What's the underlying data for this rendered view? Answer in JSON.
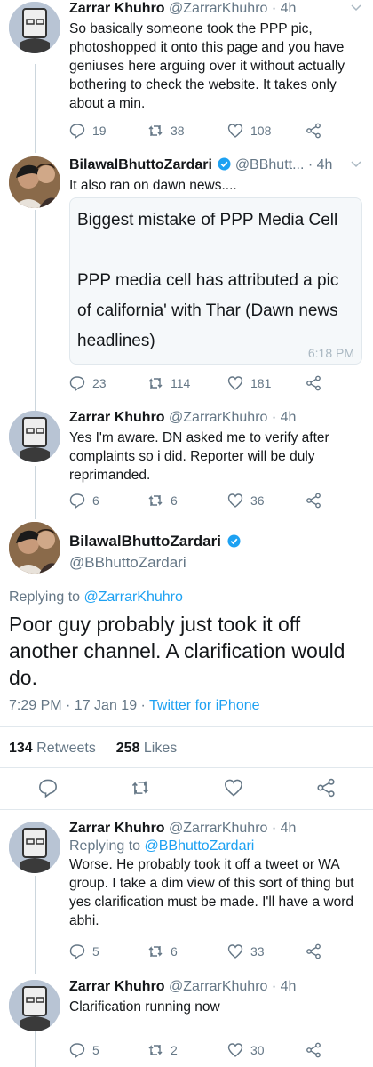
{
  "tweets": [
    {
      "name": "Zarrar Khuhro",
      "handle": "@ZarrarKhuhro",
      "time": "· 4h",
      "text": "So basically someone took the PPP pic, photoshopped it onto this page and you have geniuses here arguing over it without actually bothering to check the website. It takes only about a min.",
      "replies": "19",
      "retweets": "38",
      "likes": "108"
    },
    {
      "name": "BilawalBhuttoZardari",
      "handle": "@BBhutt...",
      "time": "· 4h",
      "text": "It also ran on dawn news....",
      "quote_text": "Biggest mistake of PPP Media Cell\n\nPPP media cell has attributed a pic of california' with Thar (Dawn news headlines)",
      "quote_time": "6:18 PM",
      "replies": "23",
      "retweets": "114",
      "likes": "181"
    },
    {
      "name": "Zarrar Khuhro",
      "handle": "@ZarrarKhuhro",
      "time": "· 4h",
      "text": "Yes I'm aware. DN asked me to verify after complaints so i did. Reporter will be duly reprimanded.",
      "replies": "6",
      "retweets": "6",
      "likes": "36"
    }
  ],
  "main": {
    "name": "BilawalBhuttoZardari",
    "handle": "@BBhuttoZardari",
    "replying_prefix": "Replying to ",
    "replying_to": "@ZarrarKhuhro",
    "text": "Poor guy probably just took it off another channel. A clarification would do.",
    "time": "7:29 PM · 17 Jan 19 · ",
    "client": "Twitter for iPhone",
    "retweet_count": "134",
    "retweet_label": " Retweets",
    "like_count": "258",
    "like_label": " Likes"
  },
  "replies_below": [
    {
      "name": "Zarrar Khuhro",
      "handle": "@ZarrarKhuhro",
      "time": "· 4h",
      "replying_prefix": "Replying to ",
      "replying_to": "@BBhuttoZardari",
      "text": "Worse. He probably took it off a tweet or WA group. I take a dim view of this sort of thing but yes clarification must be made. I'll have a word abhi.",
      "replies": "5",
      "retweets": "6",
      "likes": "33"
    },
    {
      "name": "Zarrar Khuhro",
      "handle": "@ZarrarKhuhro",
      "time": "· 4h",
      "text": "Clarification running now",
      "replies": "5",
      "retweets": "2",
      "likes": "30"
    }
  ],
  "colors": {
    "accent": "#1da1f2",
    "secondary_text": "#657786",
    "divider": "#e1e8ed"
  }
}
